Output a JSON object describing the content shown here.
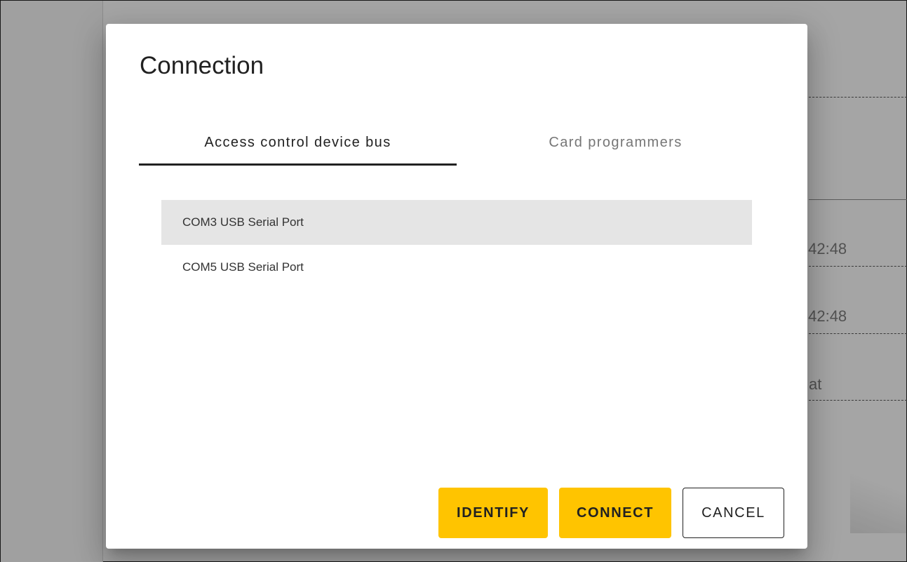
{
  "background": {
    "times": [
      ":42:48",
      ":42:48"
    ],
    "partial_text": "at"
  },
  "dialog": {
    "title": "Connection",
    "tabs": [
      {
        "label": "Access control device bus",
        "active": true
      },
      {
        "label": "Card programmers",
        "active": false
      }
    ],
    "ports": [
      {
        "label": "COM3 USB Serial Port",
        "selected": true
      },
      {
        "label": "COM5 USB Serial Port",
        "selected": false
      }
    ],
    "buttons": {
      "identify": "IDENTIFY",
      "connect": "CONNECT",
      "cancel": "CANCEL"
    }
  },
  "colors": {
    "accent": "#ffc400",
    "selected_row": "#e5e5e5",
    "text": "#212121"
  }
}
